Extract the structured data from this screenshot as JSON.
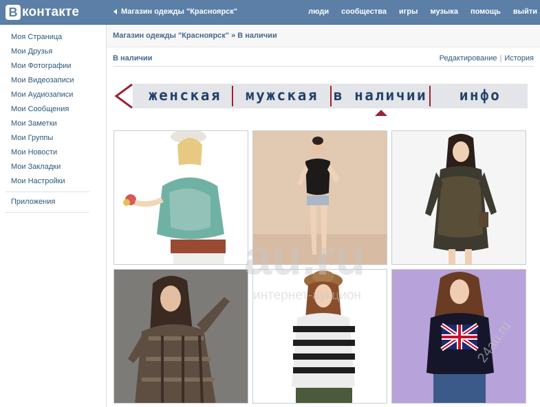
{
  "header": {
    "logo_letter": "В",
    "logo_text": "контакте",
    "back_label": "Магазин одежды \"Красноярск\"",
    "nav": [
      "люди",
      "сообщества",
      "игры",
      "музыка",
      "помощь",
      "выйти"
    ]
  },
  "left_menu": {
    "items": [
      "Моя Страница",
      "Мои Друзья",
      "Мои Фотографии",
      "Мои Видеозаписи",
      "Мои Аудиозаписи",
      "Мои Сообщения",
      "Мои Заметки",
      "Мои Группы",
      "Мои Новости",
      "Мои Закладки",
      "Мои Настройки"
    ],
    "apps": "Приложения"
  },
  "breadcrumb": {
    "group": "Магазин одежды \"Красноярск\"",
    "separator": "»",
    "current": "В наличии"
  },
  "section": {
    "title": "В наличии",
    "edit": "Редактирование",
    "divider": "|",
    "history": "История"
  },
  "tabs": {
    "items": [
      "женская",
      "мужская",
      "в наличии",
      "инфо"
    ],
    "active_index": 2,
    "accent": "#9a2233"
  },
  "watermark": {
    "main": "au.ru",
    "sub": "интернет-аукцион",
    "corner": "24au.ru"
  },
  "colors": {
    "header_bg": "#5b7fa6",
    "link": "#2b587a",
    "title": "#45688e"
  }
}
